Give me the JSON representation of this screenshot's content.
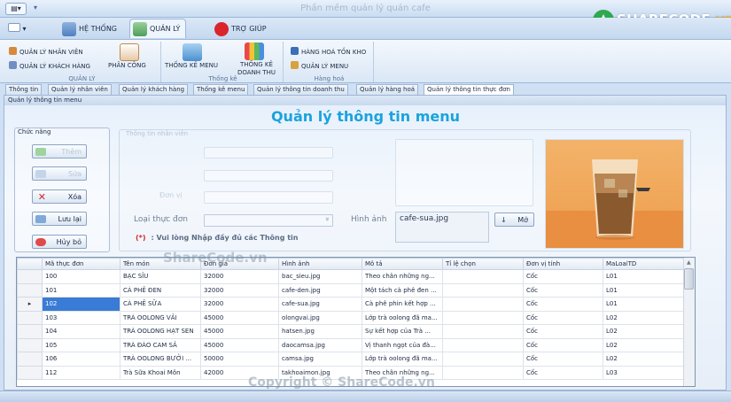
{
  "window": {
    "title": "Phần mềm quản lý quán cafe"
  },
  "ribbon_tabs": [
    {
      "label": "HỆ THỐNG"
    },
    {
      "label": "QUẢN LÝ",
      "active": true
    },
    {
      "label": "TRỢ GIÚP"
    }
  ],
  "ribbon": {
    "group1": {
      "title": "QUẢN LÝ",
      "btn1": "QUẢN LÝ NHÂN VIÊN",
      "btn2": "QUẢN LÝ KHÁCH HÀNG",
      "btn3": "PHÂN CÔNG"
    },
    "group2": {
      "title": "Thống kê",
      "btn1": "THỐNG KÊ MENU",
      "btn2_l1": "THỐNG KÊ",
      "btn2_l2": "DOANH THU"
    },
    "group3": {
      "title": "Hàng hoá",
      "btn1": "HÀNG HOÁ TỒN KHO",
      "btn2": "QUẢN LÝ MENU"
    }
  },
  "mdi_tabs": [
    "Thông tin",
    "Quản lý nhân viên",
    "Quản lý khách hàng",
    "Thống kê menu",
    "Quản lý thông tin doanh thu",
    "Quản lý hàng hoá",
    "Quản lý thông tin thực đơn"
  ],
  "form": {
    "header": "Quản lý thông tin menu",
    "title": "Quản lý thông tin menu",
    "group_functions": "Chức năng",
    "btn_add": "Thêm",
    "btn_edit": "Sửa",
    "btn_delete": "Xóa",
    "btn_save": "Lưu lại",
    "btn_cancel": "Hủy bỏ",
    "group_info": "Thông tin nhân viên",
    "label_ghost": "Đơn vị",
    "label_menu_type": "Loại thực đơn",
    "label_image": "Hình ảnh",
    "image_value": "cafe-sua.jpg",
    "btn_open": "Mở",
    "note_star": "(*)",
    "note": ": Vui lòng Nhập đầy đủ các Thông tin"
  },
  "grid": {
    "columns": [
      "Mã thực đơn",
      "Tên món",
      "Đơn giá",
      "Hình ảnh",
      "Mô tả",
      "Tỉ lệ chọn",
      "Đơn vị tính",
      "MaLoaiTD"
    ],
    "rows": [
      [
        "100",
        "BẠC SỈU",
        "32000",
        "bac_sieu.jpg",
        "Theo chân những ng...",
        "",
        "Cốc",
        "L01"
      ],
      [
        "101",
        "CÀ PHÊ ĐEN",
        "32000",
        "cafe-den.jpg",
        "Một tách cà phê đen ...",
        "",
        "Cốc",
        "L01"
      ],
      [
        "102",
        "CÀ PHÊ SỮA",
        "32000",
        "cafe-sua.jpg",
        "Cà phê phin kết hợp ...",
        "",
        "Cốc",
        "L01"
      ],
      [
        "103",
        "TRÀ OOLONG VẢI",
        "45000",
        "olongvai.jpg",
        "Lớp trà oolong đã ma...",
        "",
        "Cốc",
        "L02"
      ],
      [
        "104",
        "TRÀ OOLONG HẠT SEN",
        "45000",
        "hatsen.jpg",
        "Sự kết hợp của Trà ...",
        "",
        "Cốc",
        "L02"
      ],
      [
        "105",
        "TRÀ ĐÀO CAM SẢ",
        "45000",
        "daocamsa.jpg",
        "Vị thanh ngọt của đà...",
        "",
        "Cốc",
        "L02"
      ],
      [
        "106",
        "TRÀ OOLONG BƯỞI ...",
        "50000",
        "camsa.jpg",
        "Lớp trà oolong đã ma...",
        "",
        "Cốc",
        "L02"
      ],
      [
        "112",
        "Trà Sữa Khoai Môn",
        "42000",
        "takhoaimon.jpg",
        "Theo chân những ng...",
        "",
        "Cốc",
        "L03"
      ]
    ],
    "current_row_index": 2
  },
  "watermarks": {
    "logo_main": "SHARECODE",
    "logo_suffix": ".vn",
    "mid": "ShareCode.vn",
    "bottom": "Copyright © ShareCode.vn"
  },
  "colors": {
    "accent_title": "#1aa3dd",
    "selection": "#3a7bd5",
    "logo_orange": "#f6a21b"
  }
}
